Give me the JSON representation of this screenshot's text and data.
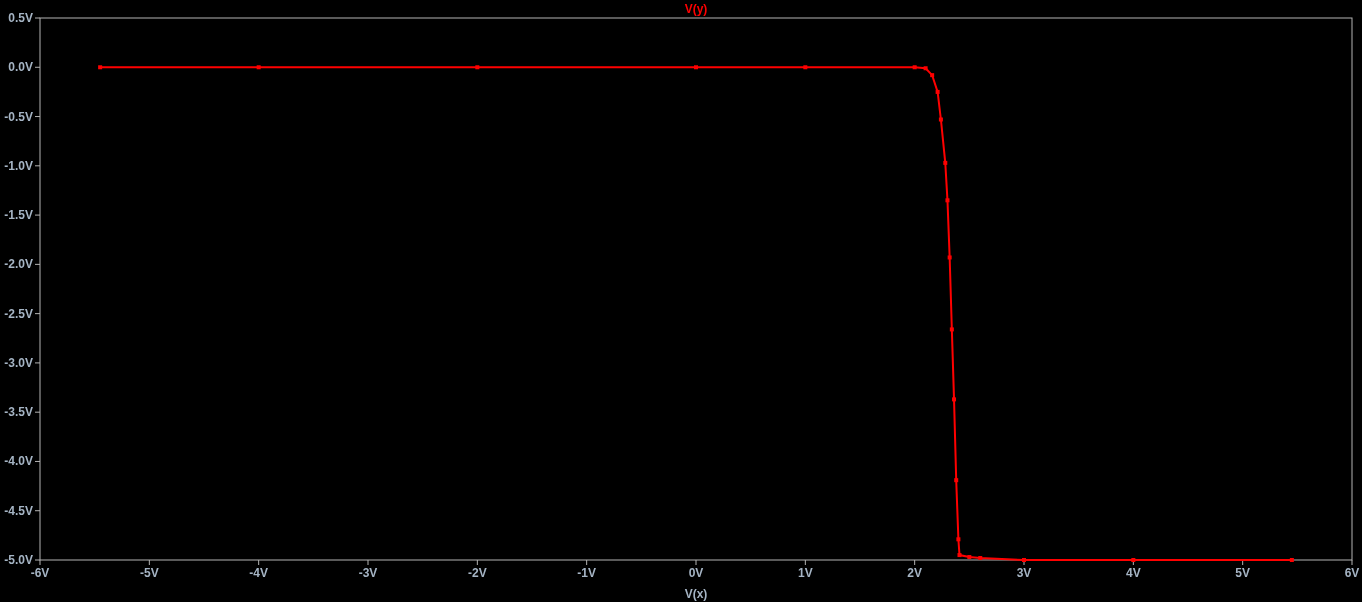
{
  "chart_data": {
    "type": "line",
    "xlabel": "V(x)",
    "xlim": [
      -6,
      6
    ],
    "ylim": [
      -5,
      0.5
    ],
    "xticks": [
      {
        "value": -6,
        "label": "-6V"
      },
      {
        "value": -5,
        "label": "-5V"
      },
      {
        "value": -4,
        "label": "-4V"
      },
      {
        "value": -3,
        "label": "-3V"
      },
      {
        "value": -2,
        "label": "-2V"
      },
      {
        "value": -1,
        "label": "-1V"
      },
      {
        "value": 0,
        "label": "0V"
      },
      {
        "value": 1,
        "label": "1V"
      },
      {
        "value": 2,
        "label": "2V"
      },
      {
        "value": 3,
        "label": "3V"
      },
      {
        "value": 4,
        "label": "4V"
      },
      {
        "value": 5,
        "label": "5V"
      },
      {
        "value": 6,
        "label": "6V"
      }
    ],
    "yticks": [
      {
        "value": 0.5,
        "label": "0.5V"
      },
      {
        "value": 0,
        "label": "0.0V"
      },
      {
        "value": -0.5,
        "label": "-0.5V"
      },
      {
        "value": -1,
        "label": "-1.0V"
      },
      {
        "value": -1.5,
        "label": "-1.5V"
      },
      {
        "value": -2,
        "label": "-2.0V"
      },
      {
        "value": -2.5,
        "label": "-2.5V"
      },
      {
        "value": -3,
        "label": "-3.0V"
      },
      {
        "value": -3.5,
        "label": "-3.5V"
      },
      {
        "value": -4,
        "label": "-4.0V"
      },
      {
        "value": -4.5,
        "label": "-4.5V"
      },
      {
        "value": -5,
        "label": "-5.0V"
      }
    ],
    "x": [
      -5.45,
      -4,
      -2,
      0,
      1,
      2.0,
      2.1,
      2.16,
      2.21,
      2.24,
      2.28,
      2.3,
      2.32,
      2.34,
      2.36,
      2.38,
      2.4,
      2.41,
      2.5,
      2.6,
      3.0,
      4,
      5.45
    ],
    "series": [
      {
        "name": "V(y)",
        "color": "#ff0000",
        "marker": "square",
        "values": [
          0,
          0,
          0,
          0,
          0,
          0,
          -0.01,
          -0.08,
          -0.25,
          -0.53,
          -0.97,
          -1.35,
          -1.93,
          -2.66,
          -3.37,
          -4.19,
          -4.79,
          -4.95,
          -4.97,
          -4.98,
          -5.0,
          -5.0,
          -5.0
        ]
      }
    ]
  }
}
